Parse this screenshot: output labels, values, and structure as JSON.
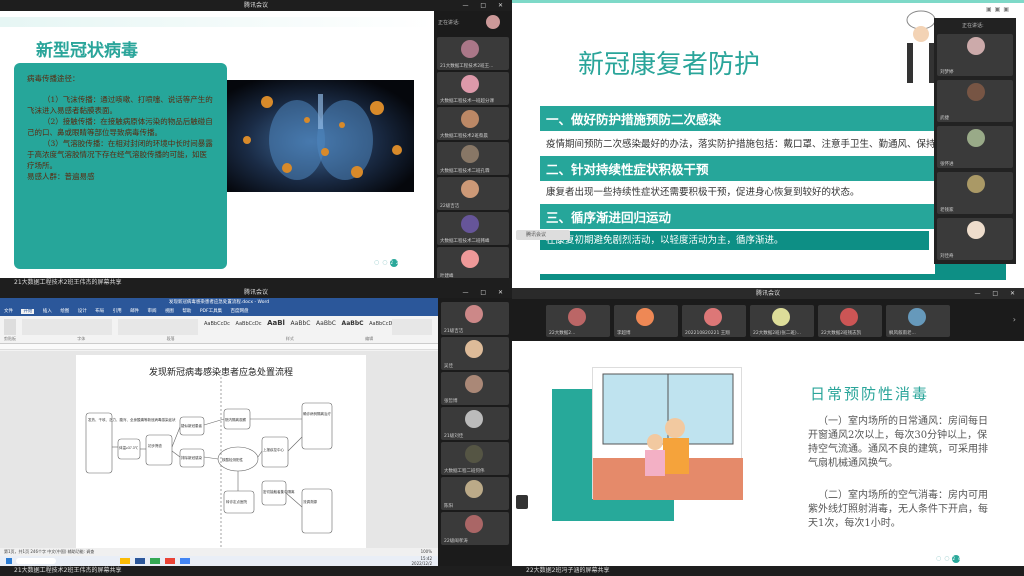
{
  "q1": {
    "window_title": "腾讯会议",
    "slide_title": "新型冠状病毒",
    "card_heading": "病毒传播途径：",
    "card_p1": "（1）飞沫传播：通过咳嗽、打喷嚏、说话等产生的飞沫进入易感者黏膜表面。",
    "card_p2": "（2）接触传播：在接触病原体污染的物品后触碰自己的口、鼻或眼睛等部位导致病毒传播。",
    "card_p3": "（3）气溶胶传播：在相对封闭的环境中长时间暴露于高浓度气溶胶情况下存在经气溶胶传播的可能，如医疗场所。",
    "card_p4": "易感人群：普遍易感",
    "side_header": "正在讲话:",
    "participants": [
      "21大数据工程技术2班王...",
      "大数据工程技术一班超分课",
      "大数据工程技术2班蔡晨",
      "大数据工程技术二班孔霖",
      "22级吉洁",
      "大数据工程技术二班韩峰",
      "叶建峰"
    ],
    "page_num": "22",
    "share_bar": "21大数据工程技术2班王伟杰的屏幕共享"
  },
  "q2": {
    "slide_title": "新冠康复者防护",
    "h1": "一、做好防护措施预防二次感染",
    "p1": "疫情期间预防二次感染最好的办法，落实防护措施包括：戴口罩、注意手卫生、勤通风、保持社交距离等。",
    "h2": "二、针对持续性症状积极干预",
    "p2": "康复者出现一些持续性症状还需要积极干预，促进身心恢复到较好的状态。",
    "h3": "三、循序渐进回归运动",
    "p3": "在康复初期避免剧烈活动，以轻度活动为主，循序渐进。",
    "side_header": "正在讲话:",
    "participants": [
      "刘梦婷",
      "武捷",
      "张怀进",
      "老钱家",
      "刘佳奇"
    ],
    "ghost_bar": "腾讯会议"
  },
  "q3": {
    "window_title": "腾讯会议",
    "word_title": "发现新冠病毒感染患者应急处置流程.docx - Word",
    "ribbon_tabs": [
      "文件",
      "开始",
      "插入",
      "绘图",
      "设计",
      "布局",
      "引用",
      "邮件",
      "审阅",
      "视图",
      "帮助",
      "PDF工具集",
      "百度网盘"
    ],
    "ribbon_styles": [
      "AaBbCcDc",
      "AaBbCcDc",
      "AaBl",
      "AaBbC",
      "AaBbC",
      "AaBbC",
      "AaBbCcD"
    ],
    "ribbon_labels": [
      "剪贴板",
      "字体",
      "段落",
      "样式",
      "编辑"
    ],
    "doc_title": "发现新冠病毒感染患者应急处置流程",
    "flow": [
      "发热、干咳、乏力、腹泻、全身酸痛等新冠病毒感染症状",
      "体温≥37.3℃",
      "初步筛查",
      "疑似新冠患者",
      "院内隔离观察",
      "排除新冠感染",
      "转诊定点医院",
      "核酸检测阳性",
      "上报疾控中心",
      "确诊病例隔离治疗",
      "流调溯源",
      "密切接触者集中隔离",
      "康复出院",
      "14天健康监测"
    ],
    "status_left": "第1页，共1页    246个字    中文(中国)    辅助功能: 调查",
    "status_right": "100%",
    "time": "15:42",
    "date": "2022/12/2",
    "share_bar": "21大数据工程技术2班王伟杰的屏幕共享",
    "participants": [
      "21级吉洁",
      "吴佳",
      "张哲博",
      "21级刘佳",
      "大数据工程二班何伟",
      "陈阳",
      "22级闽孝涛"
    ]
  },
  "q4": {
    "window_title": "腾讯会议",
    "participants": [
      "22大数据2...",
      "李超博",
      "202210820221 王翔",
      "22大数据2班(张二班)...",
      "22大数据2班钱志凯",
      "枫风叙雨老..."
    ],
    "slide_title": "日常预防性消毒",
    "p1": "（一）室内场所的日常通风：房间每日开窗通风2次以上，每次30分钟以上，保持空气流通。通风不良的建筑，可采用排气扇机械通风换气。",
    "p2": "（二）室内场所的空气消毒：房内可用紫外线灯照射消毒，无人条件下开启，每天1次，每次1小时。",
    "page_num": "24",
    "share_bar": "22大数据2班冯子涵的屏幕共享"
  },
  "colors": {
    "teal": "#26a69a",
    "teal_dark": "#0d8f85",
    "slide_title": "#2aa59a",
    "card_text": "#5a2a10",
    "dark_bar": "#1e1e1e"
  }
}
